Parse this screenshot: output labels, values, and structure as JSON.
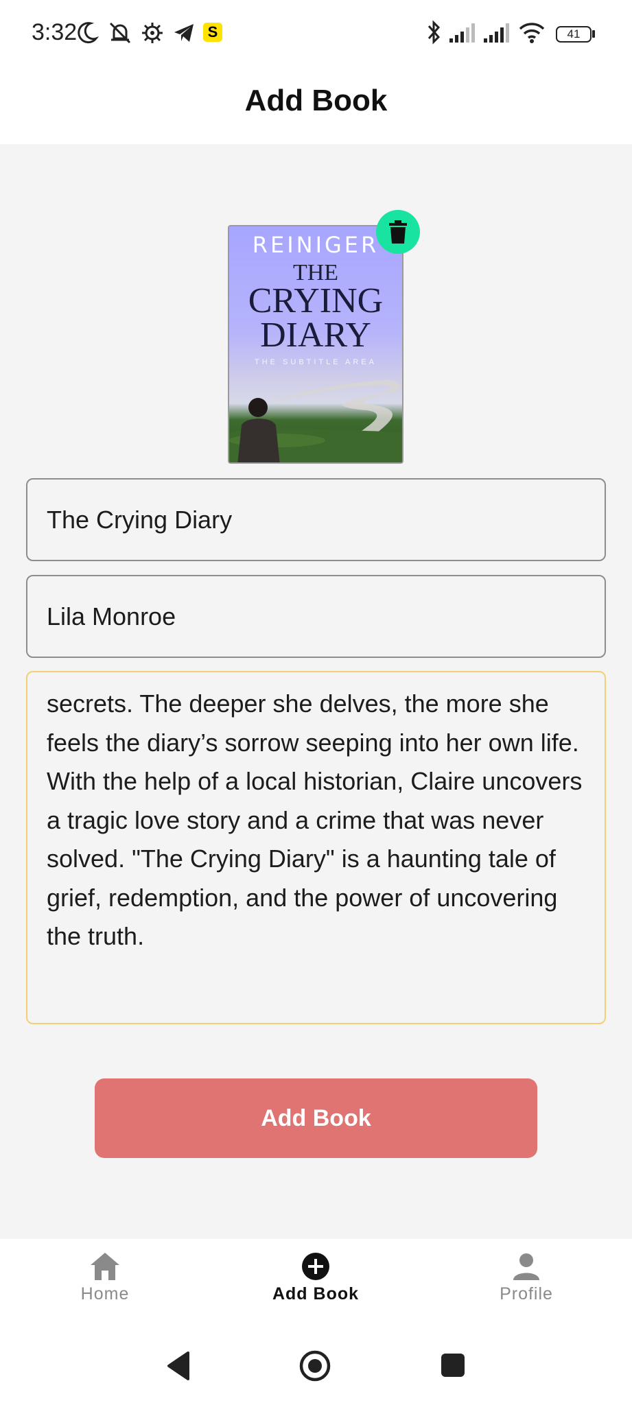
{
  "status_bar": {
    "time": "3:32",
    "app_badge": "S",
    "battery": "41"
  },
  "app_bar": {
    "title": "Add Book"
  },
  "cover": {
    "author_text": "REINIGER",
    "title_line1": "THE",
    "title_line2": "CRYING",
    "title_line3": "DIARY",
    "subtitle": "THE SUBTITLE AREA"
  },
  "form": {
    "title_value": "The Crying Diary",
    "author_value": "Lila Monroe",
    "description_value": "secrets. The deeper she delves, the more she feels the diary’s sorrow seeping into her own life. With the help of a local historian, Claire uncovers a tragic love story and a crime that was never solved. \"The Crying Diary\" is a haunting tale of grief, redemption, and the power of uncovering the truth."
  },
  "submit_label": "Add Book",
  "bottom_nav": {
    "items": [
      {
        "label": "Home",
        "icon": "home-icon",
        "active": false
      },
      {
        "label": "Add Book",
        "icon": "add-circle-icon",
        "active": true
      },
      {
        "label": "Profile",
        "icon": "person-icon",
        "active": false
      }
    ]
  },
  "colors": {
    "accent_button": "#df7472",
    "delete_fab": "#19e3a0",
    "focused_border": "#f2cf73"
  }
}
